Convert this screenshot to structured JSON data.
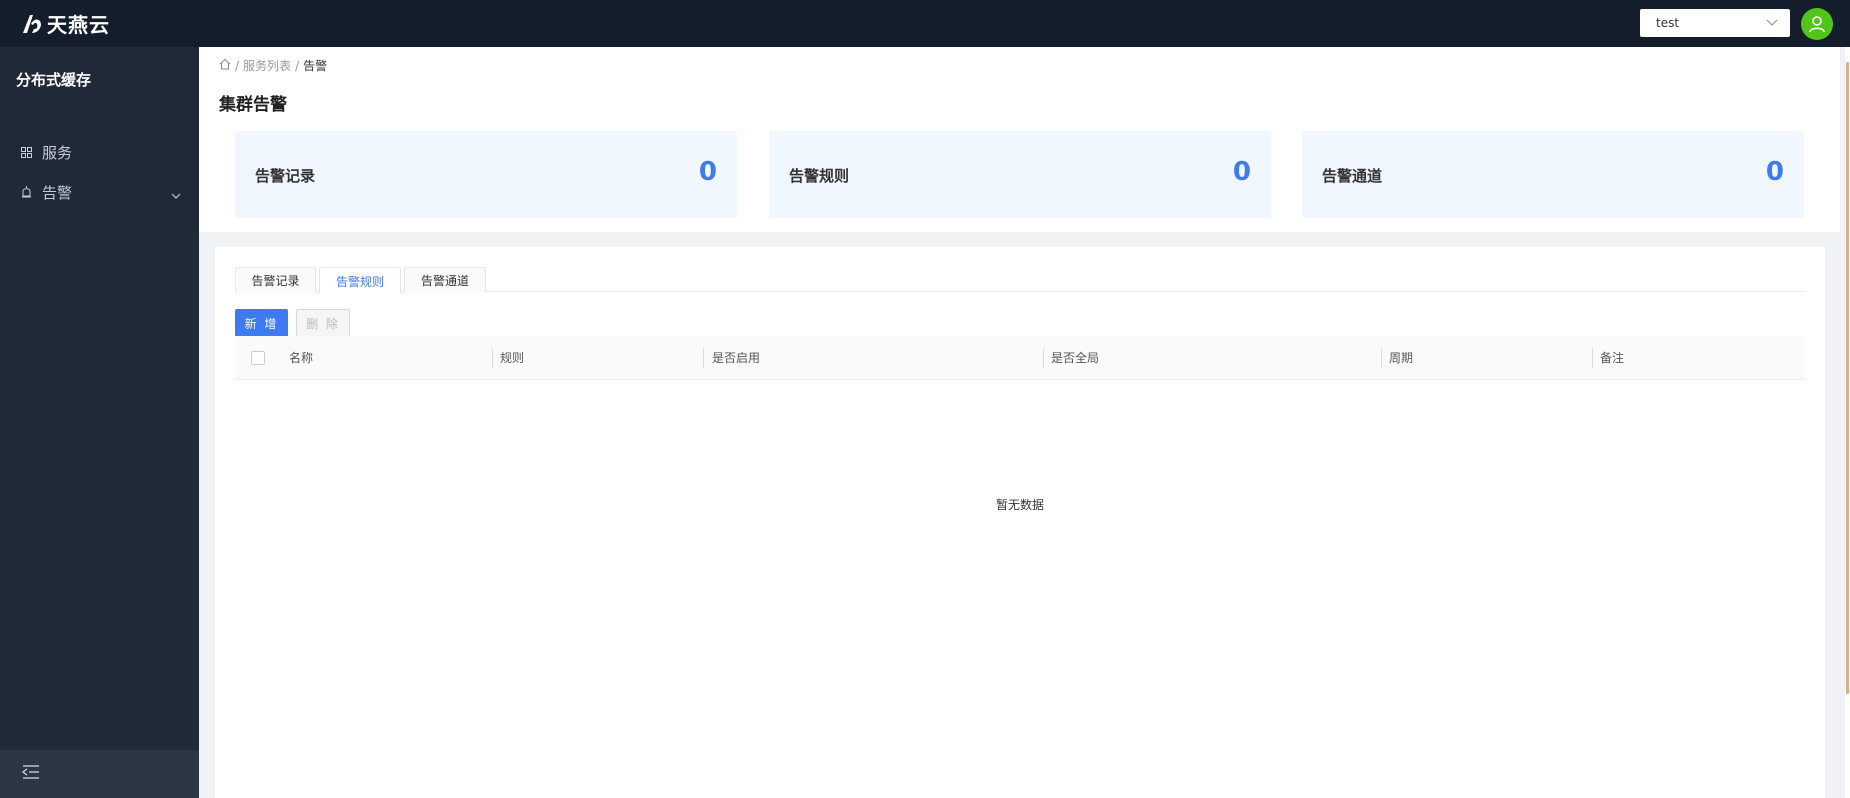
{
  "brand": {
    "name": "天燕云"
  },
  "topbar": {
    "project_value": "test"
  },
  "sidebar": {
    "title": "分布式缓存",
    "items": [
      {
        "label": "服务",
        "icon": "grid-icon"
      },
      {
        "label": "告警",
        "icon": "alarm-icon"
      }
    ]
  },
  "breadcrumb": {
    "items": [
      "服务列表",
      "告警"
    ]
  },
  "page": {
    "title": "集群告警"
  },
  "stats": [
    {
      "label": "告警记录",
      "value": "0"
    },
    {
      "label": "告警规则",
      "value": "0"
    },
    {
      "label": "告警通道",
      "value": "0"
    }
  ],
  "tabs": [
    {
      "label": "告警记录"
    },
    {
      "label": "告警规则",
      "active": true
    },
    {
      "label": "告警通道"
    }
  ],
  "actions": {
    "add_label": "新 增",
    "delete_label": "删 除"
  },
  "table": {
    "columns": [
      "名称",
      "规则",
      "是否启用",
      "是否全局",
      "周期",
      "备注"
    ],
    "rows": [],
    "empty_text": "暂无数据"
  },
  "colors": {
    "accent": "#3f7bf0",
    "topbar": "#141d2b",
    "sidebar": "#1f2937",
    "avatar": "#52c41a"
  }
}
